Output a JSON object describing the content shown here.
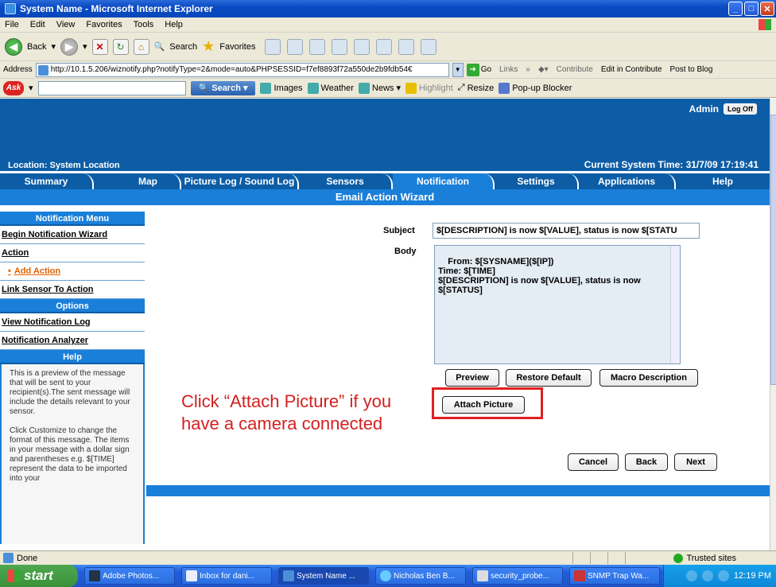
{
  "window": {
    "title": "System Name - Microsoft Internet Explorer"
  },
  "menubar": [
    "File",
    "Edit",
    "View",
    "Favorites",
    "Tools",
    "Help"
  ],
  "toolbar": {
    "back": "Back",
    "search": "Search",
    "favorites": "Favorites"
  },
  "address": {
    "label": "Address",
    "url": "http://10.1.5.206/wiznotify.php?notifyType=2&mode=auto&PHPSESSID=f7ef8893f72a550de2b9fdb54€",
    "go": "Go",
    "links": "Links",
    "contribute": "Contribute",
    "edit_contribute": "Edit in Contribute",
    "post_blog": "Post to Blog"
  },
  "askbar": {
    "logo": "Ask",
    "search": "Search",
    "items": [
      "Images",
      "Weather",
      "News",
      "Highlight",
      "Resize",
      "Pop-up Blocker"
    ]
  },
  "app": {
    "admin": "Admin",
    "logoff": "Log Off",
    "location": "Location: System Location",
    "systime": "Current System Time: 31/7/09 17:19:41",
    "tabs": [
      "Summary",
      "Map",
      "Picture Log / Sound Log",
      "Sensors",
      "Notification",
      "Settings",
      "Applications",
      "Help"
    ],
    "wizard_title": "Email Action Wizard"
  },
  "leftmenu": {
    "notification_head": "Notification Menu",
    "items": [
      "Begin Notification Wizard",
      "Action",
      "Add Action",
      "Link Sensor To Action"
    ],
    "options_head": "Options",
    "options_items": [
      "View Notification Log",
      "Notification Analyzer"
    ],
    "help_head": "Help",
    "help_p1": "This is a preview of the message that will be sent to your recipient(s).The sent message will include the details relevant to your sensor.",
    "help_p2": "Click Customize to change the format of this message. The items in your message with a dollar sign and parentheses e.g. $[TIME] represent the data to be imported into your"
  },
  "form": {
    "subject_label": "Subject",
    "subject_value": "$[DESCRIPTION] is now $[VALUE], status is now $[STATU",
    "body_label": "Body",
    "body_value": "From: $[SYSNAME]($[IP])\nTime: $[TIME]\n$[DESCRIPTION] is now $[VALUE], status is now\n$[STATUS]",
    "preview": "Preview",
    "restore": "Restore Default",
    "macro": "Macro Description",
    "attach": "Attach Picture",
    "cancel": "Cancel",
    "back": "Back",
    "next": "Next"
  },
  "callout": {
    "line1": "Click “Attach Picture” if you",
    "line2": "have a camera connected",
    "color": "#d42020"
  },
  "statusbar": {
    "done": "Done",
    "zone": "Trusted sites"
  },
  "taskbar": {
    "start": "start",
    "tasks": [
      "Adobe Photos...",
      "Inbox for dani...",
      "System Name ...",
      "Nicholas Ben B...",
      "security_probe...",
      "SNMP Trap Wa..."
    ],
    "clock": "12:19 PM"
  },
  "colors": {
    "header_blue": "#0d5da6",
    "tab_active": "#1a7fd8",
    "active_link": "#e06000"
  }
}
